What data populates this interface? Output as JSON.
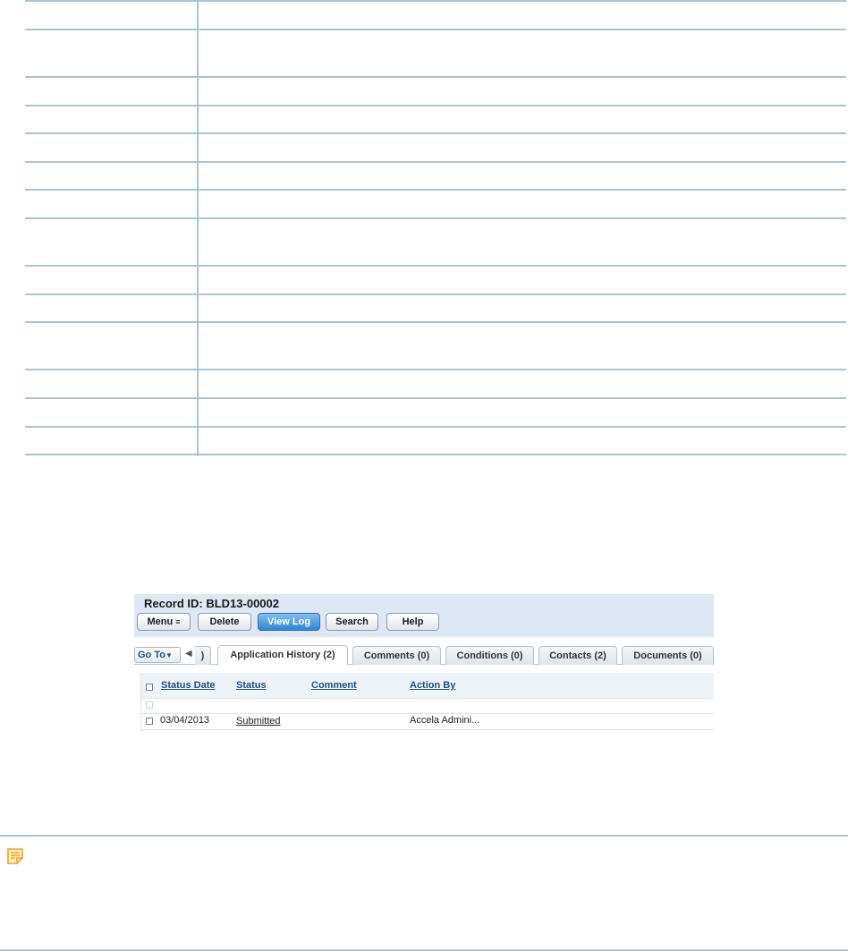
{
  "record": {
    "label": "Record ID: BLD13-00002"
  },
  "toolbar": {
    "menu_label": "Menu",
    "menu_glyph": "≡",
    "delete_label": "Delete",
    "view_log_label": "View Log",
    "search_label": "Search",
    "help_label": "Help",
    "active_color": "#3b8fd9"
  },
  "tabs": {
    "goto_label": "Go To",
    "prev_arrow": "◀",
    "clipped_label": ")",
    "items": [
      {
        "label": "Application History (2)",
        "active": true
      },
      {
        "label": "Comments (0)",
        "active": false
      },
      {
        "label": "Conditions (0)",
        "active": false
      },
      {
        "label": "Contacts (2)",
        "active": false
      },
      {
        "label": "Documents (0)",
        "active": false
      }
    ]
  },
  "grid": {
    "columns": [
      "Status Date",
      "Status",
      "Comment",
      "Action By"
    ],
    "rows": [
      {
        "status_date": "",
        "status": "",
        "comment": "",
        "action_by": ""
      },
      {
        "status_date": "03/04/2013",
        "status": "Submitted",
        "comment": "",
        "action_by": "Accela Admini..."
      }
    ]
  },
  "note": {
    "icon": "note-icon",
    "accent": "#f0a020"
  },
  "colors": {
    "rule": "#a9c4d6",
    "toolbar_bg": "#dde8f4",
    "link": "#1c4f86"
  }
}
